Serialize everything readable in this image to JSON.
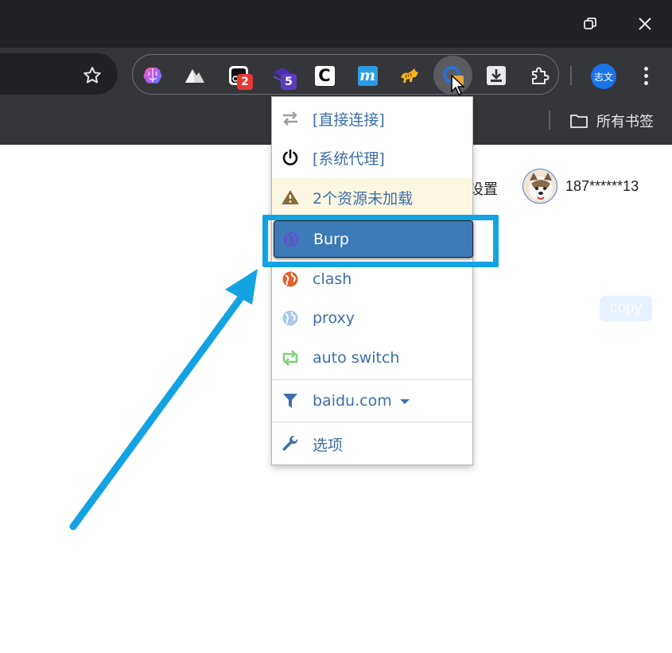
{
  "window": {
    "controls": [
      {
        "name": "restore-icon"
      },
      {
        "name": "close-icon"
      }
    ]
  },
  "toolbar": {
    "bookmark_star_icon": "star-icon",
    "extensions": [
      {
        "name": "brain-extension-icon"
      },
      {
        "name": "mountain-extension-icon"
      },
      {
        "name": "camera-extension-icon",
        "badge": "2",
        "badge_color": "#e53935"
      },
      {
        "name": "stack-extension-icon",
        "badge": "5",
        "badge_color": "#5b3cc4"
      },
      {
        "name": "c-extension-icon",
        "letter": "C"
      },
      {
        "name": "m-extension-icon",
        "letter": "m"
      },
      {
        "name": "tiger-extension-icon"
      },
      {
        "name": "switchyomega-extension-icon"
      },
      {
        "name": "download-extension-icon"
      },
      {
        "name": "puzzle-extensions-icon"
      }
    ],
    "profile_label": "志文",
    "menu_icon": "more-vert-icon"
  },
  "bookmarks_bar": {
    "all_bookmarks_label": "所有书签",
    "folder_icon": "folder-icon"
  },
  "page": {
    "settings_text": "设置",
    "user_name": "187******13",
    "copy_label": "copy"
  },
  "proxy_menu": {
    "items": [
      {
        "label": "[直接连接]",
        "icon": "transfer-icon",
        "icon_color": "#9e9e9e"
      },
      {
        "label": "[系统代理]",
        "icon": "power-icon",
        "icon_color": "#111111"
      },
      {
        "label": "2个资源未加载",
        "icon": "warning-icon",
        "icon_color": "#8a6d3b"
      },
      {
        "label": "Burp",
        "icon": "globe-icon",
        "icon_color": "#6c5dd3",
        "active": true
      },
      {
        "label": "clash",
        "icon": "globe-icon",
        "icon_color": "#e0622c"
      },
      {
        "label": "proxy",
        "icon": "globe-icon",
        "icon_color": "#a9c9ec"
      },
      {
        "label": "auto switch",
        "icon": "retweet-icon",
        "icon_color": "#7dd47d"
      },
      {
        "label": "baidu.com",
        "icon": "filter-icon",
        "icon_color": "#3e6ea8",
        "has_dropdown": true
      },
      {
        "label": "选项",
        "icon": "wrench-icon",
        "icon_color": "#3e6ea8"
      }
    ]
  },
  "annotation": {
    "box_color": "#13a3e3",
    "arrow_color": "#13a3e3"
  }
}
